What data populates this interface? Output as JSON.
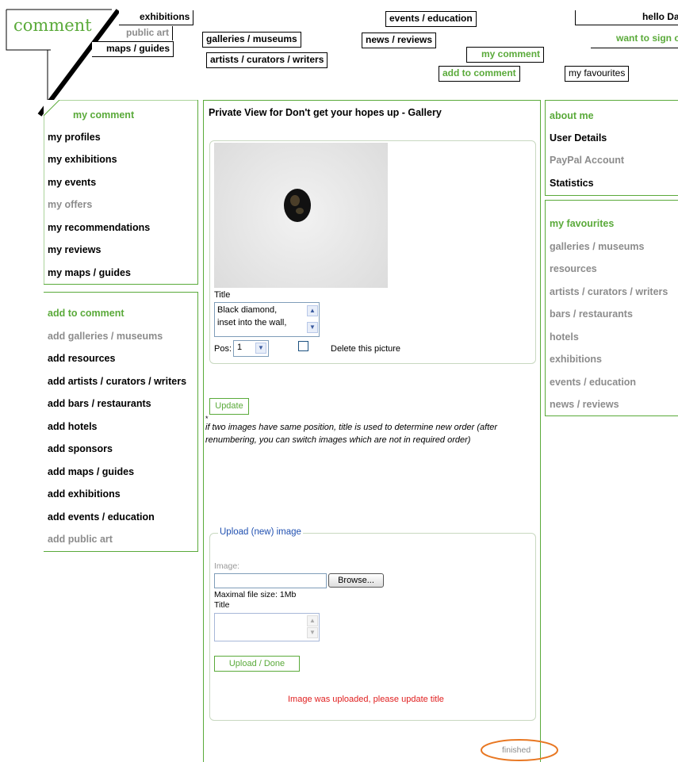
{
  "header": {
    "logo": "comment",
    "nav": {
      "exhibitions": "exhibitions",
      "public_art": "public art",
      "maps_guides": "maps / guides",
      "galleries_museums": "galleries / museums",
      "artists": "artists / curators / writers",
      "events_education": "events / education",
      "news_reviews": "news / reviews",
      "my_comment": "my comment",
      "add_to_comment": "add to comment",
      "greeting": "hello Dave",
      "sign_out": "want to sign out",
      "my_favourites": "my favourites"
    }
  },
  "left_nav": {
    "my_comment": {
      "heading": "my comment",
      "items": [
        "my profiles",
        "my exhibitions",
        "my events",
        "my offers",
        "my recommendations",
        "my reviews",
        "my maps / guides"
      ]
    },
    "add_to_comment": {
      "heading": "add to comment",
      "items": [
        "add galleries / museums",
        "add resources",
        "add artists / curators / writers",
        "add bars / restaurants",
        "add hotels",
        "add sponsors",
        "add maps / guides",
        "add exhibitions",
        "add events / education",
        "add public art"
      ]
    }
  },
  "main": {
    "title": "Private View for Don't get your hopes up - Gallery",
    "picture": {
      "title_label": "Title",
      "title_value_line1": "Black diamond,",
      "title_value_line2": "inset into the wall,",
      "pos_label": "Pos:",
      "pos_value": "1",
      "delete_label": "Delete this picture"
    },
    "update_button": "Update",
    "footnote_marker": "*",
    "footnote": "if two images have same position, title is used to determine new order (after renumbering, you can switch images which are not in required order)",
    "upload": {
      "legend": "Upload (new) image",
      "image_label": "Image:",
      "browse_button": "Browse...",
      "max_size": "Maximal file size: 1Mb",
      "title_label": "Title",
      "submit_button": "Upload / Done",
      "message": "Image was uploaded, please update title"
    },
    "finished": "finished"
  },
  "right_nav": {
    "about": {
      "heading": "about me",
      "items": [
        "User Details",
        "PayPal Account",
        "Statistics"
      ]
    },
    "favourites": {
      "heading": "my favourites",
      "items": [
        "galleries / museums",
        "resources",
        "artists / curators / writers",
        "bars / restaurants",
        "hotels",
        "exhibitions",
        "events / education",
        "news / reviews"
      ]
    }
  },
  "colors": {
    "accent": "#5aaa3a",
    "muted": "#8c8c8c",
    "error": "#e02020",
    "highlight": "#e87722"
  }
}
